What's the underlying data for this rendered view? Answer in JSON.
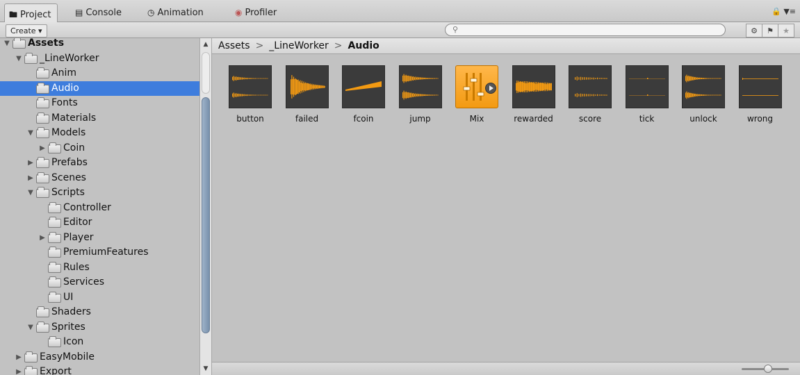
{
  "tabs": [
    {
      "label": "Project",
      "icon": "folder-icon",
      "active": true
    },
    {
      "label": "Console",
      "icon": "console-icon",
      "active": false
    },
    {
      "label": "Animation",
      "icon": "clock-icon",
      "active": false
    },
    {
      "label": "Profiler",
      "icon": "profiler-icon",
      "active": false
    }
  ],
  "toolbar": {
    "create_label": "Create ▾",
    "search_placeholder": ""
  },
  "tree": [
    {
      "label": "Assets",
      "depth": 0,
      "arrow": "open",
      "bold": true
    },
    {
      "label": "_LineWorker",
      "depth": 1,
      "arrow": "open"
    },
    {
      "label": "Anim",
      "depth": 2,
      "arrow": "none"
    },
    {
      "label": "Audio",
      "depth": 2,
      "arrow": "none",
      "selected": true
    },
    {
      "label": "Fonts",
      "depth": 2,
      "arrow": "none"
    },
    {
      "label": "Materials",
      "depth": 2,
      "arrow": "none"
    },
    {
      "label": "Models",
      "depth": 2,
      "arrow": "open"
    },
    {
      "label": "Coin",
      "depth": 3,
      "arrow": "closed"
    },
    {
      "label": "Prefabs",
      "depth": 2,
      "arrow": "closed"
    },
    {
      "label": "Scenes",
      "depth": 2,
      "arrow": "closed"
    },
    {
      "label": "Scripts",
      "depth": 2,
      "arrow": "open"
    },
    {
      "label": "Controller",
      "depth": 3,
      "arrow": "none"
    },
    {
      "label": "Editor",
      "depth": 3,
      "arrow": "none"
    },
    {
      "label": "Player",
      "depth": 3,
      "arrow": "closed"
    },
    {
      "label": "PremiumFeatures",
      "depth": 3,
      "arrow": "none"
    },
    {
      "label": "Rules",
      "depth": 3,
      "arrow": "none"
    },
    {
      "label": "Services",
      "depth": 3,
      "arrow": "none"
    },
    {
      "label": "UI",
      "depth": 3,
      "arrow": "none"
    },
    {
      "label": "Shaders",
      "depth": 2,
      "arrow": "none"
    },
    {
      "label": "Sprites",
      "depth": 2,
      "arrow": "open"
    },
    {
      "label": "Icon",
      "depth": 3,
      "arrow": "none"
    },
    {
      "label": "EasyMobile",
      "depth": 1,
      "arrow": "closed"
    },
    {
      "label": "Export",
      "depth": 1,
      "arrow": "closed"
    }
  ],
  "breadcrumb": {
    "items": [
      "Assets",
      "_LineWorker"
    ],
    "current": "Audio",
    "separator": ">"
  },
  "assets": [
    {
      "name": "button",
      "kind": "audio-clip",
      "wave": "stereo"
    },
    {
      "name": "failed",
      "kind": "audio-clip",
      "wave": "dense"
    },
    {
      "name": "fcoin",
      "kind": "audio-clip",
      "wave": "ramp"
    },
    {
      "name": "jump",
      "kind": "audio-clip",
      "wave": "stereo-fade"
    },
    {
      "name": "Mix",
      "kind": "audio-mixer",
      "wave": "mixer"
    },
    {
      "name": "rewarded",
      "kind": "audio-clip",
      "wave": "block"
    },
    {
      "name": "score",
      "kind": "audio-clip",
      "wave": "stereo-small"
    },
    {
      "name": "tick",
      "kind": "audio-clip",
      "wave": "tick"
    },
    {
      "name": "unlock",
      "kind": "audio-clip",
      "wave": "stereo-burst"
    },
    {
      "name": "wrong",
      "kind": "audio-clip",
      "wave": "flat"
    }
  ],
  "colors": {
    "selection": "#3e7ddd",
    "waveform": "#f39a12",
    "panel_bg": "#c2c2c2"
  }
}
